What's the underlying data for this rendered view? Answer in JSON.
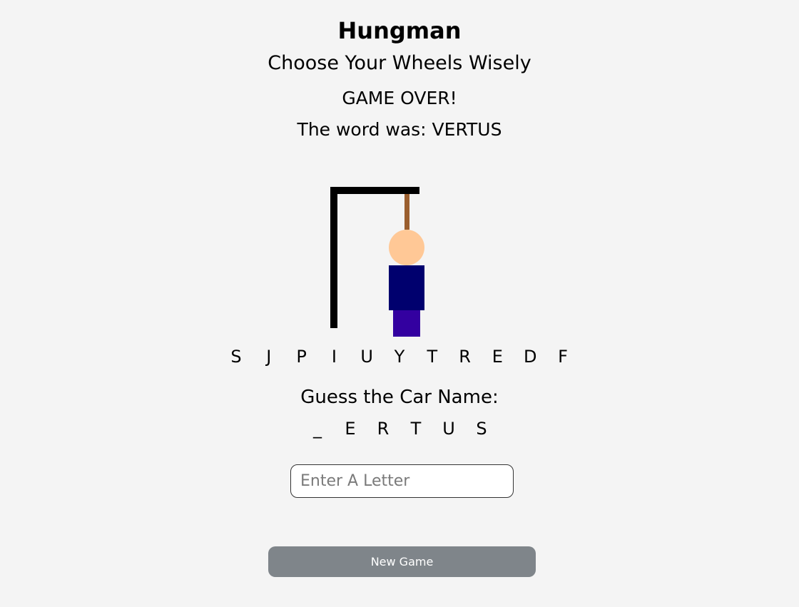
{
  "header": {
    "title": "Hungman",
    "subtitle": "Choose Your Wheels Wisely"
  },
  "status": {
    "game_over": "GAME OVER!",
    "word_reveal": "The word was: VERTUS"
  },
  "gallows": {
    "colors": {
      "frame": "#000000",
      "rope": "#9a5e2e",
      "head": "#ffc896",
      "torso": "#00006e",
      "legs": "#3300a0"
    }
  },
  "guessed_letters": [
    "S",
    "J",
    "P",
    "I",
    "U",
    "Y",
    "T",
    "R",
    "E",
    "D",
    "F"
  ],
  "puzzle": {
    "prompt": "Guess the Car Name:",
    "slots": [
      "_",
      "E",
      "R",
      "T",
      "U",
      "S"
    ]
  },
  "input": {
    "placeholder": "Enter A Letter",
    "value": ""
  },
  "buttons": {
    "new_game": "New Game"
  },
  "colors": {
    "background": "#f4f4f4",
    "button_bg": "#7f858a",
    "button_text": "#ffffff"
  }
}
